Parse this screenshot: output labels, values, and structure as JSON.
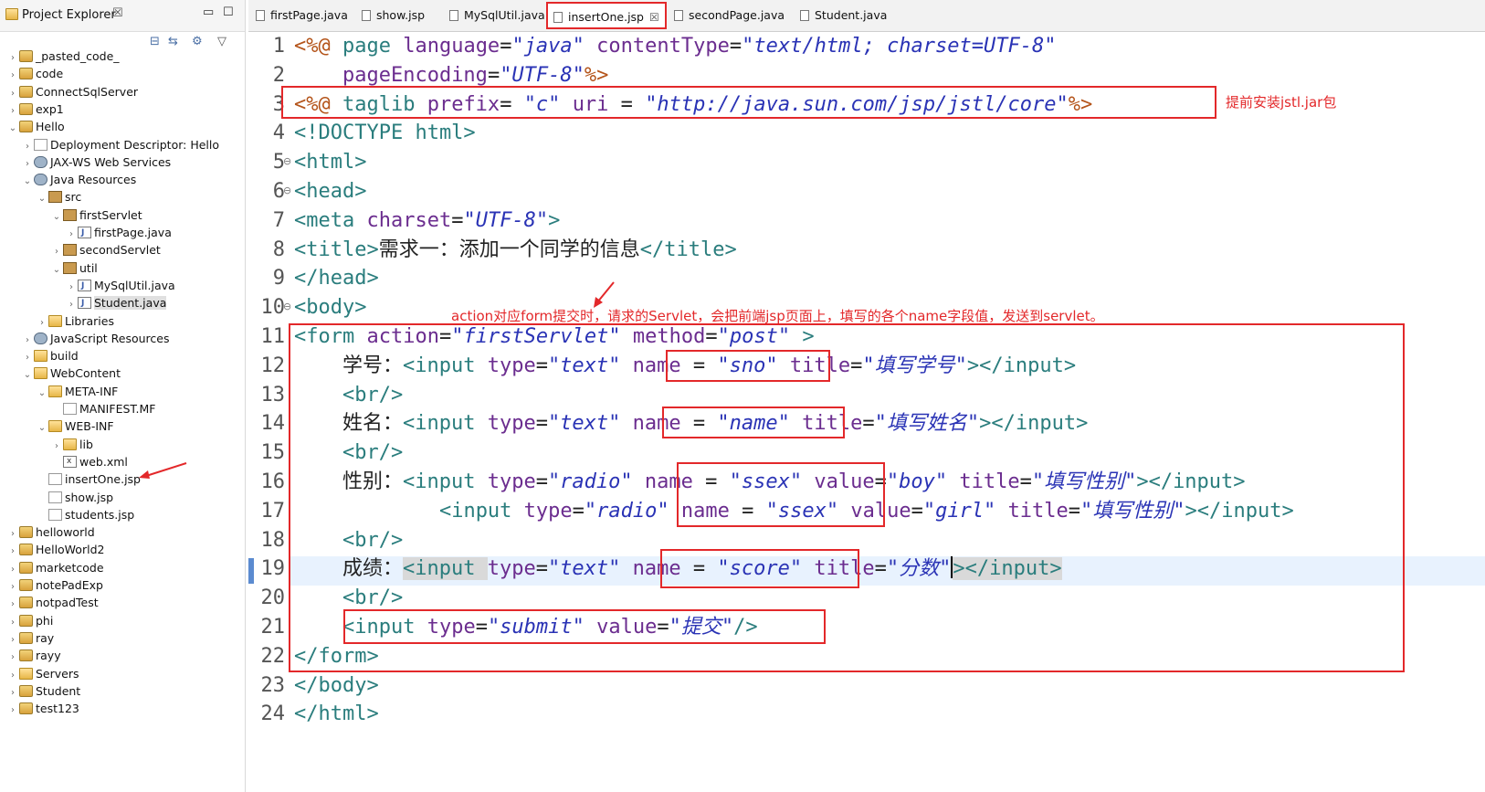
{
  "explorer": {
    "title": "Project Explorer",
    "close_symbol": "☒",
    "minimize_symbol": "▭",
    "maximize_symbol": "☐",
    "toolbar_icons": [
      "collapse-all-icon",
      "link-with-editor-icon",
      "filter-icon",
      "view-menu-icon"
    ],
    "items": [
      {
        "label": "_pasted_code_",
        "arrow": "›"
      },
      {
        "label": "code",
        "arrow": "›"
      },
      {
        "label": "ConnectSqlServer",
        "arrow": "›"
      },
      {
        "label": "exp1",
        "arrow": "›"
      },
      {
        "label": "Hello",
        "arrow": "⌄"
      },
      {
        "label": "Deployment Descriptor: Hello",
        "arrow": "›"
      },
      {
        "label": "JAX-WS Web Services",
        "arrow": "›"
      },
      {
        "label": "Java Resources",
        "arrow": "⌄"
      },
      {
        "label": "src",
        "arrow": "⌄"
      },
      {
        "label": "firstServlet",
        "arrow": "⌄"
      },
      {
        "label": "firstPage.java",
        "arrow": "›"
      },
      {
        "label": "secondServlet",
        "arrow": "›"
      },
      {
        "label": "util",
        "arrow": "⌄"
      },
      {
        "label": "MySqlUtil.java",
        "arrow": "›"
      },
      {
        "label": "Student.java",
        "arrow": "›"
      },
      {
        "label": "Libraries",
        "arrow": "›"
      },
      {
        "label": "JavaScript Resources",
        "arrow": "›"
      },
      {
        "label": "build",
        "arrow": "›"
      },
      {
        "label": "WebContent",
        "arrow": "⌄"
      },
      {
        "label": "META-INF",
        "arrow": "⌄"
      },
      {
        "label": "MANIFEST.MF",
        "arrow": ""
      },
      {
        "label": "WEB-INF",
        "arrow": "⌄"
      },
      {
        "label": "lib",
        "arrow": "›"
      },
      {
        "label": "web.xml",
        "arrow": ""
      },
      {
        "label": "insertOne.jsp",
        "arrow": ""
      },
      {
        "label": "show.jsp",
        "arrow": ""
      },
      {
        "label": "students.jsp",
        "arrow": ""
      },
      {
        "label": "helloworld",
        "arrow": "›"
      },
      {
        "label": "HelloWorld2",
        "arrow": "›"
      },
      {
        "label": "marketcode",
        "arrow": "›"
      },
      {
        "label": "notePadExp",
        "arrow": "›"
      },
      {
        "label": "notpadTest",
        "arrow": "›"
      },
      {
        "label": "phi",
        "arrow": "›"
      },
      {
        "label": "ray",
        "arrow": "›"
      },
      {
        "label": "rayy",
        "arrow": "›"
      },
      {
        "label": "Servers",
        "arrow": "›"
      },
      {
        "label": "Student",
        "arrow": "›"
      },
      {
        "label": "test123",
        "arrow": "›"
      }
    ]
  },
  "tabs": [
    {
      "label": "firstPage.java"
    },
    {
      "label": "show.jsp"
    },
    {
      "label": "MySqlUtil.java"
    },
    {
      "label": "insertOne.jsp",
      "close": "☒"
    },
    {
      "label": "secondPage.java"
    },
    {
      "label": "Student.java"
    }
  ],
  "editor": {
    "line_numbers": [
      "1",
      "2",
      "3",
      "4",
      "5",
      "6",
      "7",
      "8",
      "9",
      "10",
      "11",
      "12",
      "13",
      "14",
      "15",
      "16",
      "17",
      "18",
      "19",
      "20",
      "21",
      "22",
      "23",
      "24"
    ],
    "fold_marker": "⊖",
    "lines": [
      [
        [
          "br",
          "<%@ "
        ],
        [
          "tg",
          "page "
        ],
        [
          "at",
          "language"
        ],
        [
          "tx",
          "="
        ],
        [
          "st",
          "\"java\""
        ],
        [
          "tx",
          " "
        ],
        [
          "at",
          "contentType"
        ],
        [
          "tx",
          "="
        ],
        [
          "st",
          "\"text/html; charset=UTF-8\""
        ]
      ],
      [
        [
          "tx",
          "    "
        ],
        [
          "at",
          "pageEncoding"
        ],
        [
          "tx",
          "="
        ],
        [
          "st",
          "\"UTF-8\""
        ],
        [
          "br",
          "%>"
        ]
      ],
      [
        [
          "br",
          "<%@ "
        ],
        [
          "tg",
          "taglib "
        ],
        [
          "at",
          "prefix"
        ],
        [
          "tx",
          "= "
        ],
        [
          "st",
          "\"c\""
        ],
        [
          "tx",
          " "
        ],
        [
          "at",
          "uri"
        ],
        [
          "tx",
          " = "
        ],
        [
          "st",
          "\"http://java.sun.com/jsp/jstl/core\""
        ],
        [
          "br",
          "%>"
        ]
      ],
      [
        [
          "tg",
          "<!DOCTYPE html>"
        ]
      ],
      [
        [
          "tg",
          "<html>"
        ]
      ],
      [
        [
          "tg",
          "<head>"
        ]
      ],
      [
        [
          "tg",
          "<meta "
        ],
        [
          "at",
          "charset"
        ],
        [
          "tx",
          "="
        ],
        [
          "st",
          "\"UTF-8\""
        ],
        [
          "tg",
          ">"
        ]
      ],
      [
        [
          "tg",
          "<title>"
        ],
        [
          "tx",
          "需求一：添加一个同学的信息"
        ],
        [
          "tg",
          "</title>"
        ]
      ],
      [
        [
          "tg",
          "</head>"
        ]
      ],
      [
        [
          "tg",
          "<body>"
        ]
      ],
      [
        [
          "tg",
          "<form "
        ],
        [
          "at",
          "action"
        ],
        [
          "tx",
          "="
        ],
        [
          "st",
          "\"firstServlet\""
        ],
        [
          "tx",
          " "
        ],
        [
          "at",
          "method"
        ],
        [
          "tx",
          "="
        ],
        [
          "st",
          "\"post\""
        ],
        [
          "tx",
          " "
        ],
        [
          "tg",
          ">"
        ]
      ],
      [
        [
          "tx",
          "    学号："
        ],
        [
          "tg",
          "<input "
        ],
        [
          "at",
          "type"
        ],
        [
          "tx",
          "="
        ],
        [
          "st",
          "\"text\""
        ],
        [
          "tx",
          " "
        ],
        [
          "at",
          "name"
        ],
        [
          "tx",
          " = "
        ],
        [
          "st",
          "\"sno\""
        ],
        [
          "tx",
          " "
        ],
        [
          "at",
          "title"
        ],
        [
          "tx",
          "="
        ],
        [
          "st",
          "\"填写学号\""
        ],
        [
          "tg",
          "></input>"
        ]
      ],
      [
        [
          "tx",
          "    "
        ],
        [
          "tg",
          "<br/>"
        ]
      ],
      [
        [
          "tx",
          "    姓名："
        ],
        [
          "tg",
          "<input "
        ],
        [
          "at",
          "type"
        ],
        [
          "tx",
          "="
        ],
        [
          "st",
          "\"text\""
        ],
        [
          "tx",
          " "
        ],
        [
          "at",
          "name"
        ],
        [
          "tx",
          " = "
        ],
        [
          "st",
          "\"name\""
        ],
        [
          "tx",
          " "
        ],
        [
          "at",
          "title"
        ],
        [
          "tx",
          "="
        ],
        [
          "st",
          "\"填写姓名\""
        ],
        [
          "tg",
          "></input>"
        ]
      ],
      [
        [
          "tx",
          "    "
        ],
        [
          "tg",
          "<br/>"
        ]
      ],
      [
        [
          "tx",
          "    性别："
        ],
        [
          "tg",
          "<input "
        ],
        [
          "at",
          "type"
        ],
        [
          "tx",
          "="
        ],
        [
          "st",
          "\"radio\""
        ],
        [
          "tx",
          " "
        ],
        [
          "at",
          "name"
        ],
        [
          "tx",
          " = "
        ],
        [
          "st",
          "\"ssex\""
        ],
        [
          "tx",
          " "
        ],
        [
          "at",
          "value"
        ],
        [
          "tx",
          "="
        ],
        [
          "st",
          "\"boy\""
        ],
        [
          "tx",
          " "
        ],
        [
          "at",
          "title"
        ],
        [
          "tx",
          "="
        ],
        [
          "st",
          "\"填写性别\""
        ],
        [
          "tg",
          "></input>"
        ]
      ],
      [
        [
          "tx",
          "            "
        ],
        [
          "tg",
          "<input "
        ],
        [
          "at",
          "type"
        ],
        [
          "tx",
          "="
        ],
        [
          "st",
          "\"radio\""
        ],
        [
          "tx",
          " "
        ],
        [
          "at",
          "name"
        ],
        [
          "tx",
          " = "
        ],
        [
          "st",
          "\"ssex\""
        ],
        [
          "tx",
          " "
        ],
        [
          "at",
          "value"
        ],
        [
          "tx",
          "="
        ],
        [
          "st",
          "\"girl\""
        ],
        [
          "tx",
          " "
        ],
        [
          "at",
          "title"
        ],
        [
          "tx",
          "="
        ],
        [
          "st",
          "\"填写性别\""
        ],
        [
          "tg",
          "></input>"
        ]
      ],
      [
        [
          "tx",
          "    "
        ],
        [
          "tg",
          "<br/>"
        ]
      ],
      [
        [
          "tx",
          "    成绩："
        ],
        [
          "tg",
          "<input "
        ],
        [
          "at",
          "type"
        ],
        [
          "tx",
          "="
        ],
        [
          "st",
          "\"text\""
        ],
        [
          "tx",
          " "
        ],
        [
          "at",
          "name"
        ],
        [
          "tx",
          " = "
        ],
        [
          "st",
          "\"score\""
        ],
        [
          "tx",
          " "
        ],
        [
          "at",
          "title"
        ],
        [
          "tx",
          "="
        ],
        [
          "st",
          "\"分数\""
        ],
        [
          "tg",
          "></input>"
        ]
      ],
      [
        [
          "tx",
          "    "
        ],
        [
          "tg",
          "<br/>"
        ]
      ],
      [
        [
          "tx",
          "    "
        ],
        [
          "tg",
          "<input "
        ],
        [
          "at",
          "type"
        ],
        [
          "tx",
          "="
        ],
        [
          "st",
          "\"submit\""
        ],
        [
          "tx",
          " "
        ],
        [
          "at",
          "value"
        ],
        [
          "tx",
          "="
        ],
        [
          "st",
          "\"提交\""
        ],
        [
          "tg",
          "/>"
        ]
      ],
      [
        [
          "tg",
          "</form>"
        ]
      ],
      [
        [
          "tg",
          "</body>"
        ]
      ],
      [
        [
          "tg",
          "</html>"
        ]
      ]
    ]
  },
  "annotations": {
    "jstl_note": "提前安装jstl.jar包",
    "action_note": "action对应form提交时，请求的Servlet，会把前端jsp页面上，填写的各个name字段值，发送到servlet。"
  },
  "colors": {
    "annotation_red": "#e3282a",
    "tag": "#2a7d7d",
    "attribute": "#6b2d8f",
    "string": "#2a33b5",
    "current_line": "#e8f2fe"
  }
}
